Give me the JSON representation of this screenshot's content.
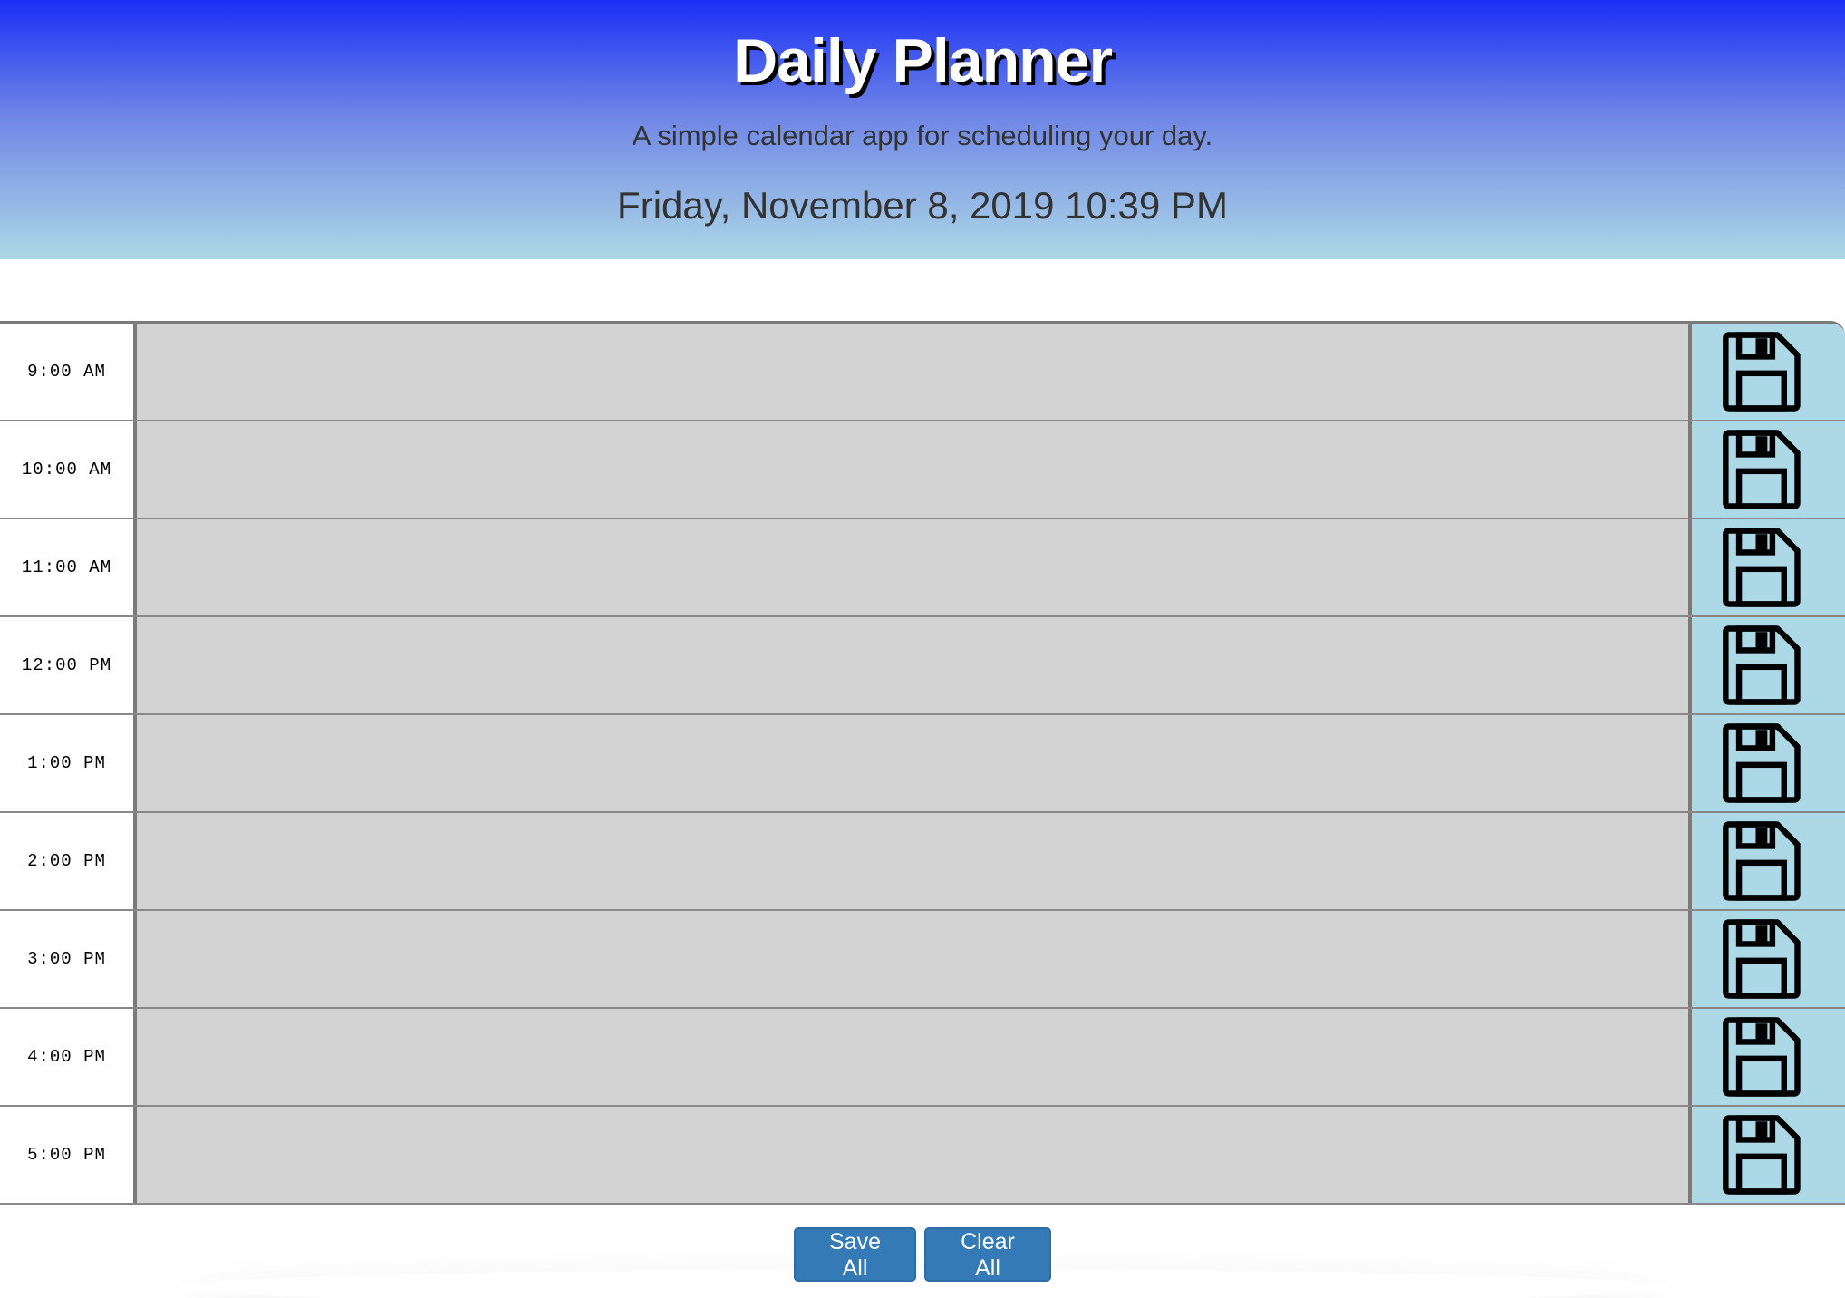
{
  "header": {
    "title": "Daily Planner",
    "lead": "A simple calendar app for scheduling your day.",
    "current_day": "Friday, November 8, 2019 10:39 PM"
  },
  "colors": {
    "header_top": "#1a2ff6",
    "header_bottom": "#add8e6",
    "past_block": "#d3d3d3",
    "save_button": "#add8e6",
    "action_button": "#337ab7"
  },
  "hours": [
    {
      "label": "9:00 AM",
      "text": ""
    },
    {
      "label": "10:00 AM",
      "text": ""
    },
    {
      "label": "11:00 AM",
      "text": ""
    },
    {
      "label": "12:00 PM",
      "text": ""
    },
    {
      "label": "1:00 PM",
      "text": ""
    },
    {
      "label": "2:00 PM",
      "text": ""
    },
    {
      "label": "3:00 PM",
      "text": ""
    },
    {
      "label": "4:00 PM",
      "text": ""
    },
    {
      "label": "5:00 PM",
      "text": ""
    }
  ],
  "save_icon": "floppy-disk-icon",
  "actions": {
    "save_all": "Save All",
    "clear_all": "Clear All"
  }
}
